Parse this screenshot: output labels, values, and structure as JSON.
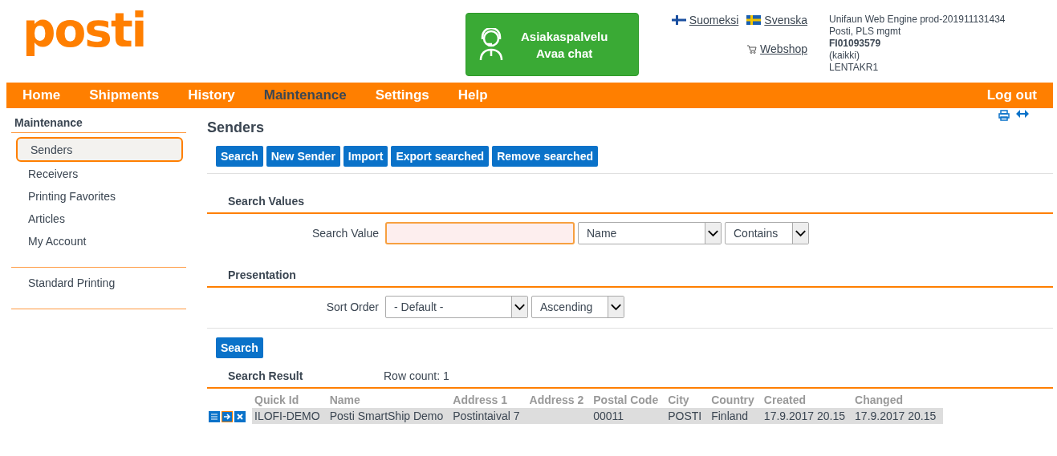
{
  "logo": {
    "text": "posti"
  },
  "chat": {
    "line1": "Asiakaspalvelu",
    "line2": "Avaa chat"
  },
  "languages": [
    {
      "label": "Suomeksi",
      "kind": "fi"
    },
    {
      "label": "Svenska",
      "kind": "se"
    }
  ],
  "webshop": "Webshop",
  "account": {
    "engine": "Unifaun Web Engine prod-201911131434",
    "company": "Posti, PLS mgmt",
    "customer_number": "FI01093579",
    "scope": "(kaikki)",
    "user": "LENTAKR1"
  },
  "nav": {
    "items": [
      {
        "label": "Home",
        "selected": false
      },
      {
        "label": "Shipments",
        "selected": false
      },
      {
        "label": "History",
        "selected": false
      },
      {
        "label": "Maintenance",
        "selected": true
      },
      {
        "label": "Settings",
        "selected": false
      },
      {
        "label": "Help",
        "selected": false
      }
    ],
    "logout": "Log out"
  },
  "sidebar": {
    "title": "Maintenance",
    "groups": [
      [
        {
          "label": "Senders",
          "selected": true
        },
        {
          "label": "Receivers",
          "selected": false
        },
        {
          "label": "Printing Favorites",
          "selected": false
        },
        {
          "label": "Articles",
          "selected": false
        },
        {
          "label": "My Account",
          "selected": false
        }
      ],
      [
        {
          "label": "Standard Printing",
          "selected": false
        }
      ]
    ]
  },
  "page_title": "Senders",
  "toolbar": [
    "Search",
    "New Sender",
    "Import",
    "Export searched",
    "Remove searched"
  ],
  "search_values": {
    "title": "Search Values",
    "label": "Search Value",
    "field_select": "Name",
    "match_select": "Contains"
  },
  "presentation": {
    "title": "Presentation",
    "label": "Sort Order",
    "sort_select": "- Default -",
    "direction_select": "Ascending"
  },
  "search_button": "Search",
  "result": {
    "title": "Search Result",
    "row_count": "Row count: 1",
    "columns": [
      "Quick Id",
      "Name",
      "Address 1",
      "Address 2",
      "Postal Code",
      "City",
      "Country",
      "Created",
      "Changed"
    ],
    "rows": [
      [
        "ILOFI-DEMO",
        "Posti SmartShip Demo",
        "Postintaival 7",
        "",
        "00011",
        "POSTI",
        "Finland",
        "17.9.2017 20.15",
        "17.9.2017 20.15"
      ]
    ]
  }
}
